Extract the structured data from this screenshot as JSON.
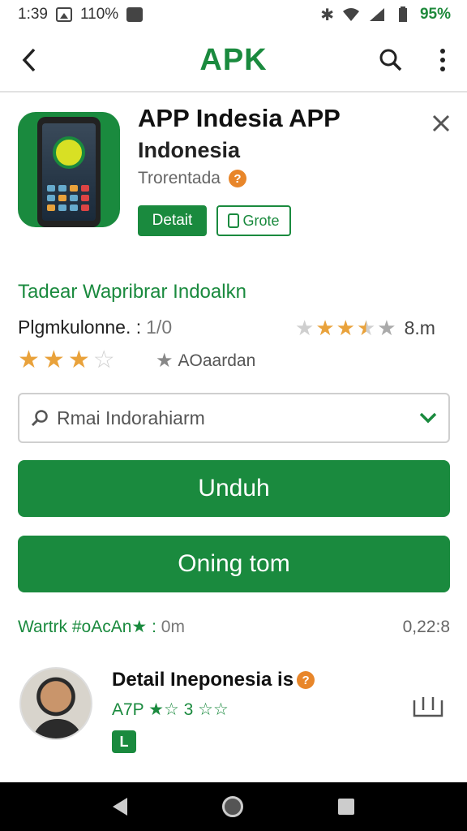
{
  "status_bar": {
    "time": "1:39",
    "notif_text": "110%",
    "battery": "95%"
  },
  "app_bar": {
    "title": "APK"
  },
  "app": {
    "name": "APP Indesia APP",
    "subtitle": "Indonesia",
    "developer": "Trorentada",
    "verified_mark": "?",
    "detail_label": "Detait",
    "grote_label": "Grote"
  },
  "info": {
    "tagline": "Tadear Wapribrar Indoalkn",
    "downloads_label": "Plgmkulonne. :",
    "downloads_value": "1/0",
    "rating_right_count": "8.m",
    "award_label": "AOaardan"
  },
  "colors": {
    "accent": "#1a8a3e",
    "star": "#e9a23b",
    "verified": "#e8862a"
  },
  "search": {
    "value": "Rmai Indorahiarm"
  },
  "buttons": {
    "primary": "Unduh",
    "secondary": "Oning tom"
  },
  "meta": {
    "left_label": "Wartrk #oAcAn★ :",
    "left_value": "0m",
    "right": "0,22:8"
  },
  "review": {
    "title": "Detail Ineponesia is",
    "subtitle": "A7P ★☆ 3 ☆☆",
    "badge": "L"
  }
}
